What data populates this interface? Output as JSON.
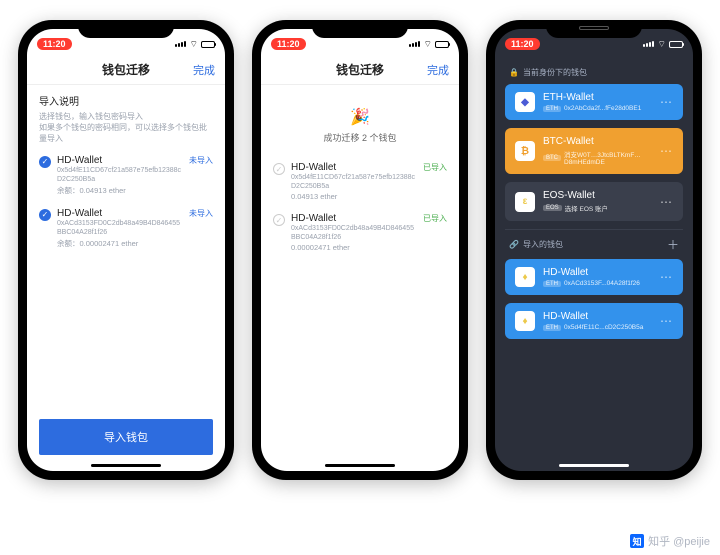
{
  "time": "11:20",
  "phone1": {
    "nav_title": "钱包迁移",
    "done": "完成",
    "desc_title": "导入说明",
    "desc_line1": "选择钱包，输入钱包密码导入",
    "desc_line2": "如果多个钱包的密码相同，可以选择多个钱包批量导入",
    "wallets": [
      {
        "name": "HD-Wallet",
        "addr": "0x5d4fE11CD67cf21a587e75efb12388cD2C250B5a",
        "balance": "余额：0.04913 ether",
        "status": "未导入"
      },
      {
        "name": "HD-Wallet",
        "addr": "0xACd3153FD0C2db48a49B4D846455BBC04A28f1f26",
        "balance": "余额：0.00002471 ether",
        "status": "未导入"
      }
    ],
    "cta": "导入钱包"
  },
  "phone2": {
    "nav_title": "钱包迁移",
    "done": "完成",
    "success_text": "成功迁移 2 个钱包",
    "wallets": [
      {
        "name": "HD-Wallet",
        "addr": "0x5d4fE11CD67cf21a587e75efb12388cD2C250B5a",
        "balance": "0.04913 ether",
        "status": "已导入"
      },
      {
        "name": "HD-Wallet",
        "addr": "0xACd3153FD0C2db48a49B4D846455BBC04A28f1f26",
        "balance": "0.00002471 ether",
        "status": "已导入"
      }
    ]
  },
  "phone3": {
    "section1": "当前身份下的钱包",
    "section2": "导入的钱包",
    "cards1": [
      {
        "icon": "◆",
        "icon_bg": "#fff",
        "icon_color": "#4b5bd6",
        "bg": "#3392ec",
        "name": "ETH-Wallet",
        "tag": "ETH",
        "addr": "0x2AbCda2f...fFe28d0BE1"
      },
      {
        "icon": "₿",
        "icon_bg": "#fff",
        "icon_color": "#f0a030",
        "bg": "#f0a030",
        "name": "BTC-Wallet",
        "tag": "BTC",
        "addr": "消支W0T…3JtcBLTKmF…D8mHEdmDE"
      },
      {
        "icon": "ε",
        "icon_bg": "#fff",
        "icon_color": "#ecc94b",
        "bg": "#3a3f4c",
        "name": "EOS-Wallet",
        "tag": "EOS",
        "addr": "选择 EOS 账户"
      }
    ],
    "cards2": [
      {
        "icon": "♦",
        "icon_bg": "#fff",
        "icon_color": "#ecc94b",
        "bg": "#3392ec",
        "name": "HD-Wallet",
        "tag": "ETH",
        "addr": "0xACd3153F...04A28f1f26"
      },
      {
        "icon": "♦",
        "icon_bg": "#fff",
        "icon_color": "#ecc94b",
        "bg": "#3392ec",
        "name": "HD-Wallet",
        "tag": "ETH",
        "addr": "0x5d4fE11C...cD2C250B5a"
      }
    ]
  },
  "watermark": "知乎 @peijie"
}
